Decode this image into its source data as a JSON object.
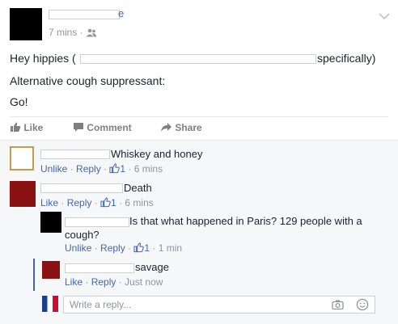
{
  "post": {
    "time": "7 mins",
    "dot": "·",
    "author_tail": "e",
    "line1_prefix": "Hey hippies (",
    "line1_suffix": "specifically)",
    "line2": "Alternative cough suppressant:",
    "line3": "Go!"
  },
  "actions": {
    "like": "Like",
    "comment": "Comment",
    "share": "Share"
  },
  "comments": [
    {
      "text": "Whiskey and honey",
      "action1": "Unlike",
      "action2": "Reply",
      "likes": "1",
      "time": "6 mins"
    },
    {
      "text": "Death",
      "action1": "Like",
      "action2": "Reply",
      "likes": "1",
      "time": "6 mins"
    }
  ],
  "replies": [
    {
      "text_line1": "Is that what happened in Paris? 129 people with a",
      "text_line2": "cough?",
      "action1": "Unlike",
      "action2": "Reply",
      "likes": "1",
      "time": "1 min"
    },
    {
      "text": "savage",
      "action1": "Like",
      "action2": "Reply",
      "time": "Just now"
    }
  ],
  "reply_box": {
    "placeholder": "Write a reply..."
  },
  "colors": {
    "link": "#4267b2",
    "meta": "#90949c",
    "avatar_red": "#8a1212"
  }
}
